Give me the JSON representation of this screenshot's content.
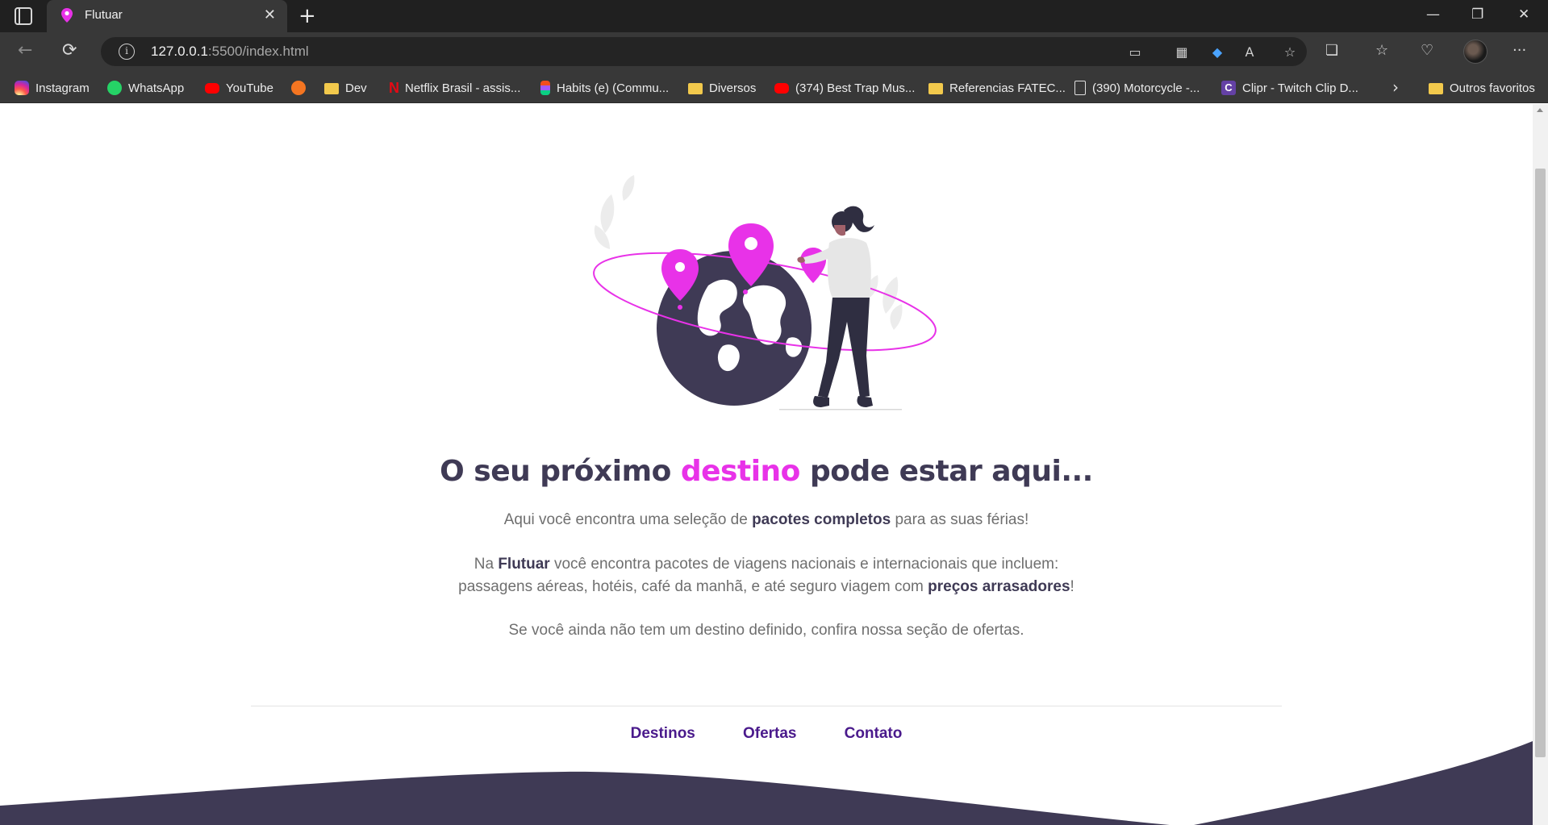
{
  "browser": {
    "tab_title": "Flutuar",
    "new_tab_symbol": "+",
    "close_tab_symbol": "✕",
    "url_host": "127.0.0.1",
    "url_path": ":5500/index.html",
    "window_controls": {
      "minimize": "—",
      "restore": "❐",
      "close": "✕"
    },
    "bookmarks": [
      {
        "label": "Instagram",
        "icon": "instagram-icon"
      },
      {
        "label": "WhatsApp",
        "icon": "whatsapp-icon"
      },
      {
        "label": "YouTube",
        "icon": "youtube-icon"
      },
      {
        "label": "",
        "icon": "crunchyroll-icon"
      },
      {
        "label": "Dev",
        "icon": "folder-icon"
      },
      {
        "label": "Netflix Brasil - assis...",
        "icon": "netflix-icon"
      },
      {
        "label": "Habits (e) (Commu...",
        "icon": "figma-icon"
      },
      {
        "label": "Diversos",
        "icon": "folder-icon"
      },
      {
        "label": "(374) Best Trap Mus...",
        "icon": "youtube-icon"
      },
      {
        "label": "Referencias FATEC...",
        "icon": "folder-icon"
      },
      {
        "label": "(390) Motorcycle -...",
        "icon": "document-icon"
      },
      {
        "label": "Clipr - Twitch Clip D...",
        "icon": "clipr-icon"
      }
    ],
    "other_favorites": "Outros favoritos"
  },
  "page": {
    "headline_pre": "O seu próximo ",
    "headline_accent": "destino",
    "headline_post": " pode estar aqui...",
    "p1_a": "Aqui você encontra uma seleção de ",
    "p1_b": "pacotes completos",
    "p1_c": " para as suas férias!",
    "p2_a": "Na ",
    "p2_b": "Flutuar",
    "p2_c": " você encontra pacotes de viagens nacionais e internacionais que incluem:",
    "p2_d": "passagens aéreas, hotéis, café da manhã, e até seguro viagem com ",
    "p2_e": "preços arrasadores",
    "p2_f": "!",
    "p3": "Se você ainda não tem um destino definido, confira nossa seção de ofertas.",
    "nav": [
      "Destinos",
      "Ofertas",
      "Contato"
    ]
  },
  "colors": {
    "accent": "#e832e8",
    "dark": "#3f3a55",
    "nav_link": "#4a1a8c"
  }
}
